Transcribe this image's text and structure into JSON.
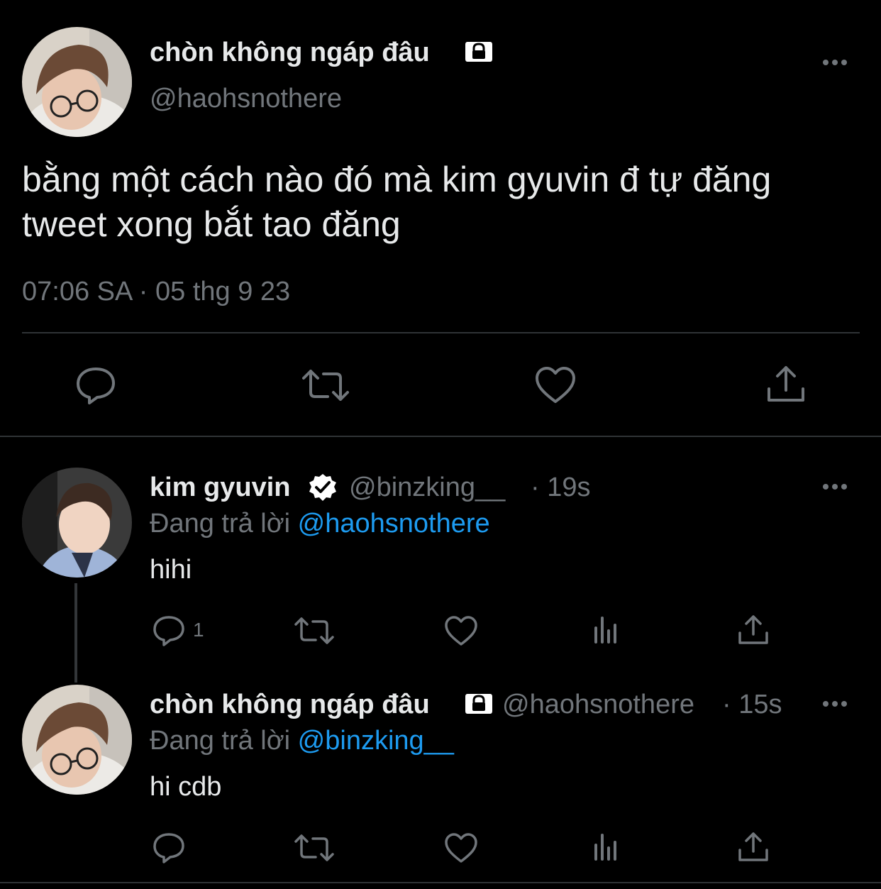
{
  "main_tweet": {
    "display_name": "chòn không ngáp đâu",
    "handle": "@haohsnothere",
    "text_line1": "bằng một cách nào đó mà kim gyuvin đ tự đăng",
    "text_line2": "tweet xong bắt tao đăng",
    "timestamp": "07:06 SA · 05 thg 9 23",
    "protected_icon": "lock-icon",
    "actions": [
      "reply-icon",
      "retweet-icon",
      "like-icon",
      "share-icon"
    ]
  },
  "reply1": {
    "display_name": "kim gyuvin",
    "handle": "@binzking__",
    "time": "· 19s",
    "replying_prefix": "Đang trả lời",
    "replying_to": "@haohsnothere",
    "text": "hihi",
    "reply_count": "1",
    "verified_icon": "verified-badge-icon"
  },
  "reply2": {
    "display_name": "chòn không ngáp đâu",
    "handle": "@haohsnothere",
    "time": "· 15s",
    "replying_prefix": "Đang trả lời",
    "replying_to": "@binzking__",
    "text": "hi cdb",
    "protected_icon": "lock-icon"
  },
  "colors": {
    "background": "#000000",
    "text": "#e7e9ea",
    "muted": "#71767b",
    "link": "#1d9bf0",
    "divider": "#2f3336"
  }
}
